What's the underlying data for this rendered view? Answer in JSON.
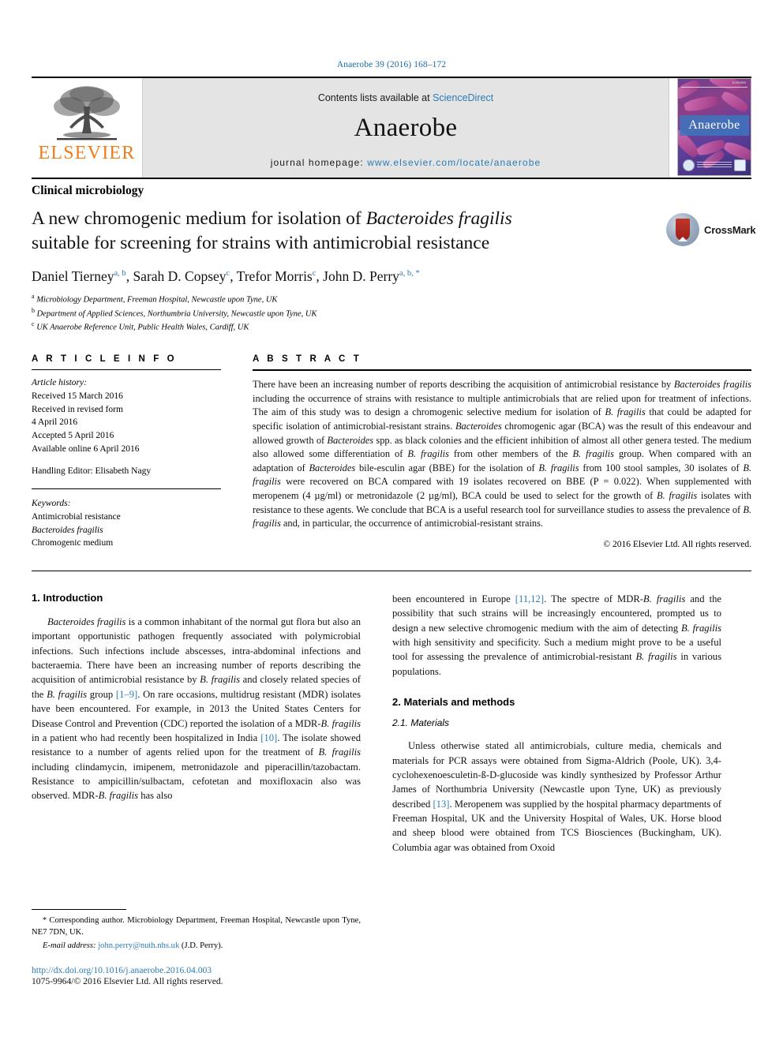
{
  "running_head": "Anaerobe 39 (2016) 168–172",
  "masthead": {
    "publisher_name": "ELSEVIER",
    "publisher_logo_icon": "elsevier-tree-icon",
    "contents_prefix": "Contents lists available at ",
    "contents_link": "ScienceDirect",
    "journal_title": "Anaerobe",
    "homepage_prefix": "journal homepage: ",
    "homepage_url": "www.elsevier.com/locate/anaerobe",
    "cover_title": "Anaerobe",
    "cover_top_text": "ELSEVIER"
  },
  "category": "Clinical microbiology",
  "crossmark": {
    "label": "CrossMark",
    "icon": "crossmark-icon"
  },
  "title": {
    "line1_pre": "A new chromogenic medium for isolation of ",
    "line1_italic": "Bacteroides fragilis",
    "line2": "suitable for screening for strains with antimicrobial resistance"
  },
  "authors": {
    "list": [
      {
        "name": "Daniel Tierney",
        "sup": "a, b"
      },
      {
        "name": "Sarah D. Copsey",
        "sup": "c"
      },
      {
        "name": "Trefor Morris",
        "sup": "c"
      },
      {
        "name": "John D. Perry",
        "sup": "a, b, *"
      }
    ],
    "affiliations": [
      {
        "mark": "a",
        "text": "Microbiology Department, Freeman Hospital, Newcastle upon Tyne, UK"
      },
      {
        "mark": "b",
        "text": "Department of Applied Sciences, Northumbria University, Newcastle upon Tyne, UK"
      },
      {
        "mark": "c",
        "text": "UK Anaerobe Reference Unit, Public Health Wales, Cardiff, UK"
      }
    ]
  },
  "article_info": {
    "heading": "A R T I C L E   I N F O",
    "history_label": "Article history:",
    "history": [
      "Received 15 March 2016",
      "Received in revised form",
      "4 April 2016",
      "Accepted 5 April 2016",
      "Available online 6 April 2016"
    ],
    "handling_editor": "Handling Editor: Elisabeth Nagy",
    "keywords_label": "Keywords:",
    "keywords": [
      "Antimicrobial resistance",
      "Bacteroides fragilis",
      "Chromogenic medium"
    ]
  },
  "abstract": {
    "heading": "A B S T R A C T",
    "copyright": "© 2016 Elsevier Ltd. All rights reserved."
  },
  "body": {
    "intro_heading": "1. Introduction",
    "methods_heading": "2. Materials and methods",
    "materials_subheading": "2.1. Materials"
  },
  "footnote": {
    "star": "*",
    "corresponding": "Corresponding author. Microbiology Department, Freeman Hospital, Newcastle upon Tyne, NE7 7DN, UK.",
    "email_label": "E-mail address:",
    "email": "john.perry@nuth.nhs.uk",
    "email_owner": "(J.D. Perry).",
    "doi": "http://dx.doi.org/10.1016/j.anaerobe.2016.04.003",
    "issn": "1075-9964/© 2016 Elsevier Ltd. All rights reserved."
  },
  "colors": {
    "link": "#2a7cb5",
    "elsevier_orange": "#f07d1a",
    "band_gray": "#e4e4e4"
  }
}
